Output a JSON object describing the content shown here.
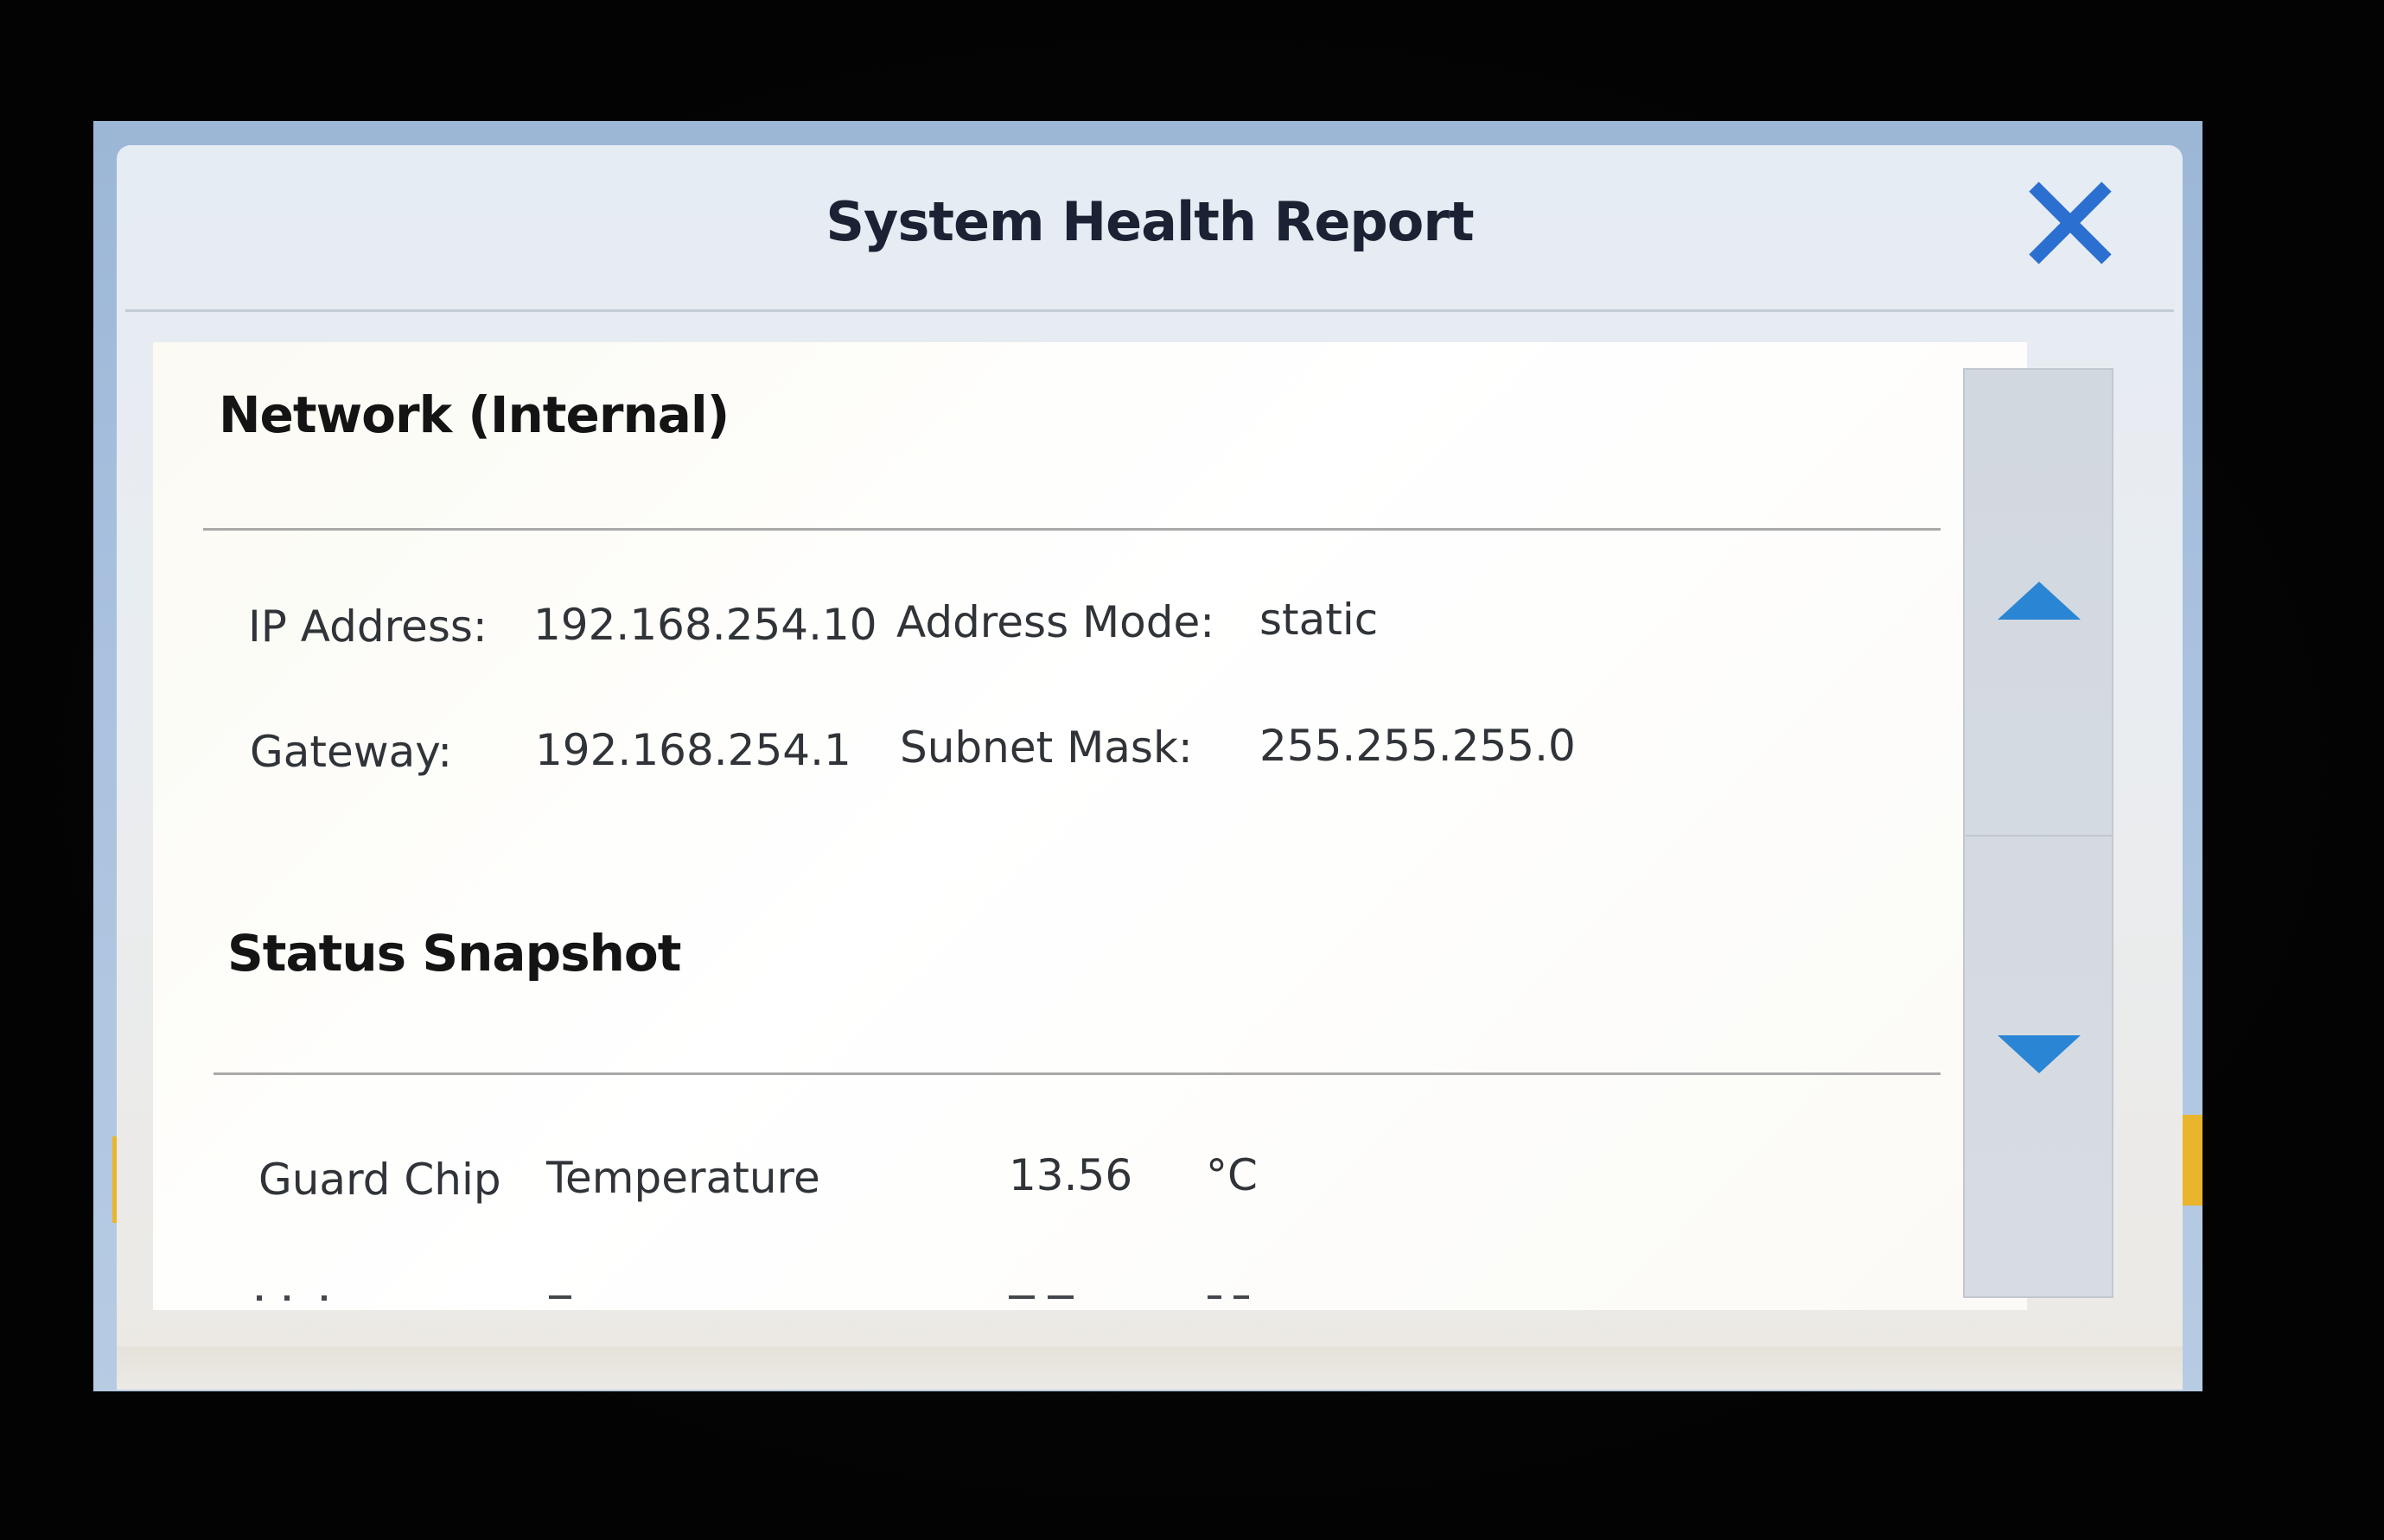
{
  "dialog": {
    "title": "System Health Report",
    "close_icon": "close-icon",
    "colors": {
      "close_icon": "#2b6fd1",
      "scroll_arrow": "#2a86d4",
      "accent": "#e8b52c"
    }
  },
  "network_section": {
    "title": "Network (Internal)",
    "fields": {
      "ip_address_label": "IP Address:",
      "ip_address_value": "192.168.254.10",
      "address_mode_label": "Address Mode:",
      "address_mode_value": "static",
      "gateway_label": "Gateway:",
      "gateway_value": "192.168.254.1",
      "subnet_mask_label": "Subnet Mask:",
      "subnet_mask_value": "255.255.255.0"
    }
  },
  "status_section": {
    "title": "Status Snapshot",
    "rows": [
      {
        "component": "Guard Chip",
        "metric": "Temperature",
        "value": "13.56",
        "unit": "°C"
      }
    ]
  },
  "scrollbar": {
    "up_icon": "triangle-up-icon",
    "down_icon": "triangle-down-icon"
  }
}
